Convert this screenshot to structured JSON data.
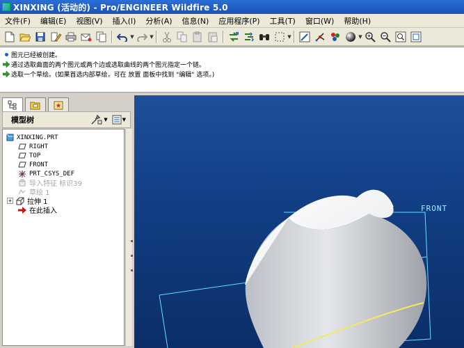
{
  "window": {
    "title": "XINXING (活动的) - Pro/ENGINEER Wildfire 5.0"
  },
  "menu": [
    "文件(F)",
    "编辑(E)",
    "视图(V)",
    "插入(I)",
    "分析(A)",
    "信息(N)",
    "应用程序(P)",
    "工具(T)",
    "窗口(W)",
    "帮助(H)"
  ],
  "toolbar": {
    "icons": [
      "new-icon",
      "open-icon",
      "save-icon",
      "edit-icon",
      "print-icon",
      "send-icon",
      "copy-doc-icon",
      "undo-icon",
      "redo-icon",
      "cut-icon",
      "copy-icon",
      "paste-icon",
      "paste-special-icon",
      "regenerate-icon",
      "find-icon",
      "select-box-icon",
      "repaint-icon",
      "spin-center-icon",
      "orient-icon",
      "shade-icon",
      "zoom-in-icon",
      "zoom-out-icon",
      "refit-icon",
      "view-icon"
    ]
  },
  "messages": [
    {
      "type": "info",
      "text": "图元已经被创建。"
    },
    {
      "type": "prompt",
      "text": "通过选取曲面的两个图元或两个边或选取曲线的两个图元指定一个链。"
    },
    {
      "type": "prompt",
      "text": "选取一个草绘。(如果首选内部草绘，可在 放置 面板中找到 \"编辑\" 选项。)"
    }
  ],
  "model_tree": {
    "title": "模型树",
    "items": [
      {
        "label": "XINXING.PRT",
        "icon": "part-icon",
        "dim": false
      },
      {
        "label": "RIGHT",
        "icon": "datum-plane-icon",
        "dim": false
      },
      {
        "label": "TOP",
        "icon": "datum-plane-icon",
        "dim": false
      },
      {
        "label": "FRONT",
        "icon": "datum-plane-icon",
        "dim": false
      },
      {
        "label": "PRT_CSYS_DEF",
        "icon": "csys-icon",
        "dim": false
      },
      {
        "label": "导入特征 标识39",
        "icon": "import-feature-icon",
        "dim": true
      },
      {
        "label": "草绘 1",
        "icon": "sketch-icon",
        "dim": true
      },
      {
        "label": "拉伸 1",
        "icon": "extrude-icon",
        "dim": false
      },
      {
        "label": "在此插入",
        "icon": "insert-here-icon",
        "dim": false
      }
    ]
  },
  "graphics": {
    "datum_label": "FRONT"
  }
}
